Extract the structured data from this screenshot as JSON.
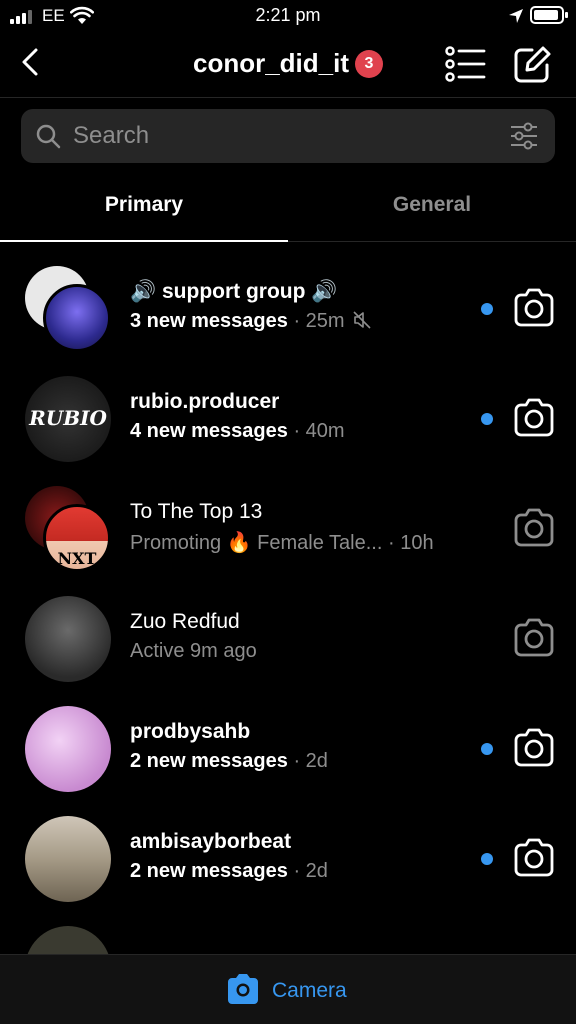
{
  "status_bar": {
    "carrier": "EE",
    "time": "2:21 pm"
  },
  "header": {
    "username": "conor_did_it",
    "badge_count": "3"
  },
  "search": {
    "placeholder": "Search"
  },
  "tabs": [
    {
      "label": "Primary",
      "selected": true
    },
    {
      "label": "General",
      "selected": false
    }
  ],
  "threads": [
    {
      "name": "🔊 support group 🔊",
      "preview": "3 new messages",
      "time": "· 25m",
      "unread": true,
      "muted": true,
      "avatar_colors": [
        "#e8e8e8",
        "#3b3da8"
      ]
    },
    {
      "name": "rubio.producer",
      "preview": "4 new messages",
      "time": "· 40m",
      "unread": true,
      "muted": false,
      "avatar_colors": [
        "#1a1a1a"
      ],
      "avatar_text": "RUBIO"
    },
    {
      "name": "To The Top 13",
      "preview": "Promoting 🔥  Female Tale...",
      "time": "· 10h",
      "unread": false,
      "muted": false,
      "avatar_colors": [
        "#5a1010",
        "#d9352b"
      ],
      "avatar_text": "NXT"
    },
    {
      "name": "Zuo Redfud",
      "preview": "Active 9m ago",
      "time": "",
      "unread": false,
      "muted": false,
      "avatar_colors": [
        "#4a4a4a"
      ]
    },
    {
      "name": "prodbysahb",
      "preview": "2 new messages",
      "time": "· 2d",
      "unread": true,
      "muted": false,
      "avatar_colors": [
        "#d9a6e0"
      ]
    },
    {
      "name": "ambisayborbeat",
      "preview": "2 new messages",
      "time": "· 2d",
      "unread": true,
      "muted": false,
      "avatar_colors": [
        "#9b8e7a"
      ]
    }
  ],
  "bottom_bar": {
    "label": "Camera"
  },
  "colors": {
    "accent": "#3797f0",
    "badge": "#e0424e",
    "muted_text": "#8e8e8e",
    "search_bg": "#262626"
  }
}
